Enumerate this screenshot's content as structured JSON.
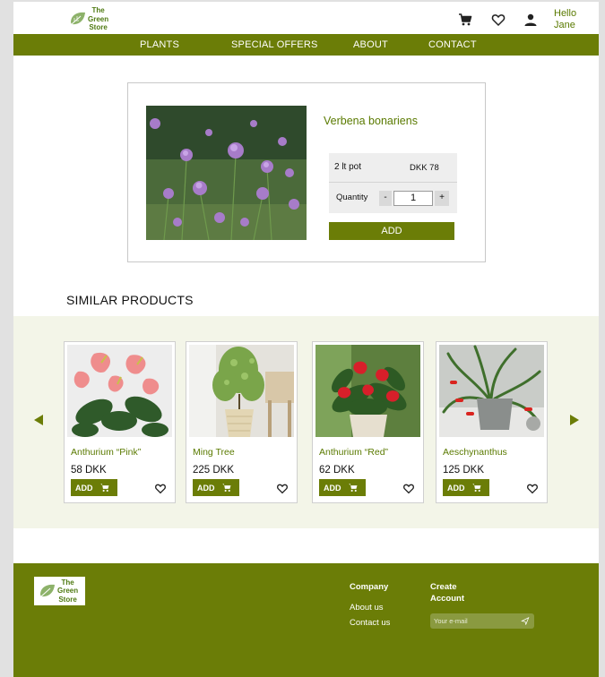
{
  "header": {
    "logo_lines": [
      "The",
      "Green",
      "Store"
    ],
    "greeting_line1": "Hello",
    "greeting_line2": "Jane",
    "icons": [
      "cart-icon",
      "heart-icon",
      "user-icon"
    ]
  },
  "nav": {
    "items": [
      "PLANTS",
      "SPECIAL OFFERS",
      "ABOUT",
      "CONTACT"
    ]
  },
  "product": {
    "title": "Verbena bonariens",
    "size_label": "2 lt pot",
    "price": "DKK 78",
    "quantity_label": "Quantity",
    "minus": "-",
    "quantity_value": "1",
    "plus": "+",
    "add_label": "ADD"
  },
  "similar": {
    "title": "SIMILAR PRODUCTS",
    "items": [
      {
        "name": "Anthurium “Pink”",
        "price": "58 DKK",
        "add_label": "ADD"
      },
      {
        "name": "Ming Tree",
        "price": "225 DKK",
        "add_label": "ADD"
      },
      {
        "name": "Anthurium “Red”",
        "price": "62 DKK",
        "add_label": "ADD"
      },
      {
        "name": "Aeschynanthus",
        "price": "125 DKK",
        "add_label": "ADD"
      }
    ]
  },
  "footer": {
    "logo_lines": [
      "The",
      "Green",
      "Store"
    ],
    "company_heading": "Company",
    "links": [
      "About us",
      "Contact us"
    ],
    "create_line1": "Create",
    "create_line2": "Account",
    "email_placeholder": "Your e-mail"
  },
  "colors": {
    "brand_green": "#6b7d07",
    "text_green": "#5a7a00",
    "band_bg": "#f3f5e8"
  }
}
